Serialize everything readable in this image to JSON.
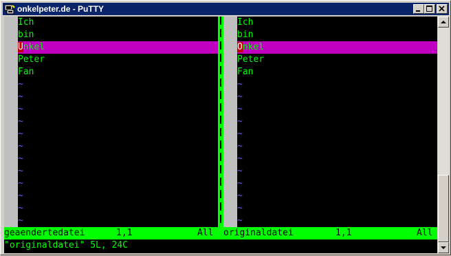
{
  "window": {
    "title": "onkelpeter.de - PuTTY"
  },
  "icons": {
    "app": "putty-icon",
    "minimize": "minimize-icon",
    "maximize": "maximize-icon",
    "close": "close-icon"
  },
  "left_pane": {
    "lines": [
      {
        "first": "",
        "rest": "Ich"
      },
      {
        "first": "",
        "rest": "bin"
      },
      {
        "first": "U",
        "rest": "nkel"
      },
      {
        "first": "",
        "rest": "Peter"
      },
      {
        "first": "",
        "rest": "Fan"
      }
    ],
    "status_name": "geaendertedatei",
    "status_pos": "1,1",
    "status_all": "All"
  },
  "right_pane": {
    "lines": [
      {
        "first": "",
        "rest": "Ich"
      },
      {
        "first": "",
        "rest": "bin"
      },
      {
        "first": "O",
        "rest": "nkel"
      },
      {
        "first": "",
        "rest": "Peter"
      },
      {
        "first": "",
        "rest": "Fan"
      }
    ],
    "status_name": "originaldatei",
    "status_pos": "1,1",
    "status_all": "All"
  },
  "tilde": "~",
  "command_line": "\"originaldatei\" 5L, 24C",
  "colors": {
    "text": "#00ff00",
    "highlight": "#c000c0",
    "diff_char": "#c00000",
    "tilde": "#5f5fff",
    "titlebar": "#0a246a"
  }
}
